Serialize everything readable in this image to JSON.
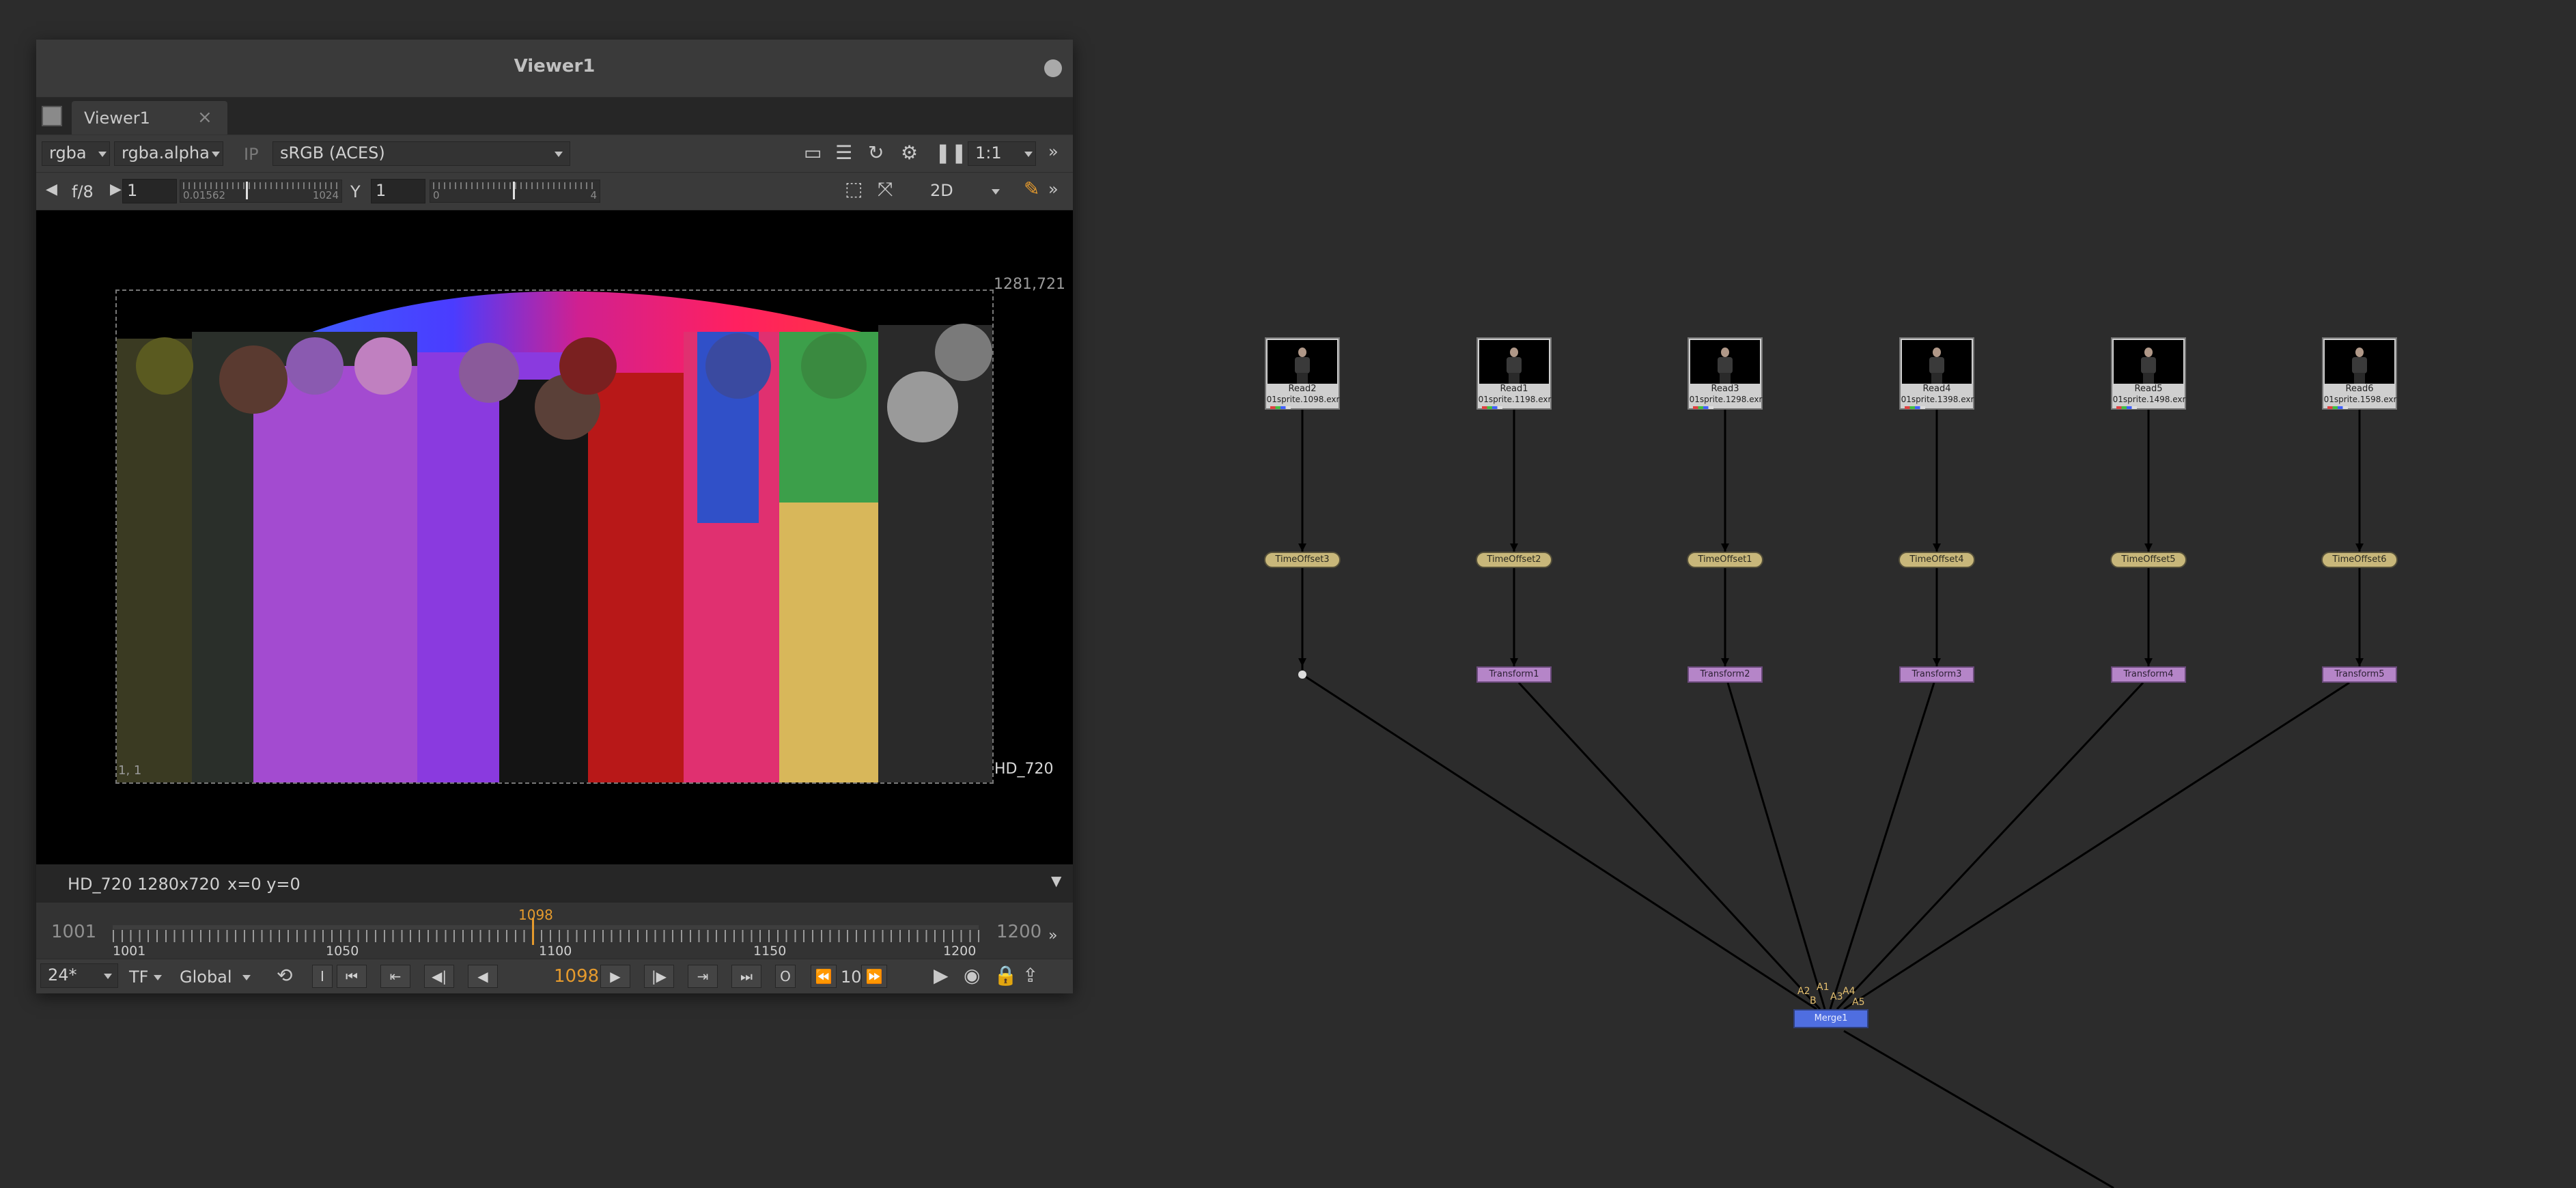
{
  "viewer": {
    "title": "Viewer1",
    "tab_label": "Viewer1",
    "toolbar1": {
      "channels": "rgba",
      "alpha_channel": "rgba.alpha",
      "ip_label": "IP",
      "colorspace": "sRGB (ACES)",
      "zoom": "1:1"
    },
    "toolbar2": {
      "fstop": "f/8",
      "gain_value": "1",
      "gain_ticks": "0.01562",
      "gain_max": "1024",
      "y_label": "Y",
      "gamma_value": "1",
      "gamma_min": "0",
      "gamma_max": "4",
      "view_mode": "2D"
    },
    "canvas": {
      "format_corner": "1281,721",
      "format_name": "HD_720",
      "origin_label": "1, 1"
    },
    "info": {
      "format": "HD_720 1280x720",
      "coords": "x=0 y=0"
    },
    "timeline": {
      "range_start": "1001",
      "range_end": "1200",
      "current_frame": "1098",
      "labels": [
        "1001",
        "1050",
        "1100",
        "1150",
        "1200"
      ]
    },
    "playback": {
      "fps": "24*",
      "tf": "TF",
      "scope": "Global",
      "in_label": "I",
      "out_label": "O",
      "frame": "1098",
      "step": "10"
    }
  },
  "nodes": {
    "reads": [
      {
        "name": "Read2",
        "file": "01sprite.1098.exr"
      },
      {
        "name": "Read1",
        "file": "01sprite.1198.exr"
      },
      {
        "name": "Read3",
        "file": "01sprite.1298.exr"
      },
      {
        "name": "Read4",
        "file": "01sprite.1398.exr"
      },
      {
        "name": "Read5",
        "file": "01sprite.1498.exr"
      },
      {
        "name": "Read6",
        "file": "01sprite.1598.exr"
      }
    ],
    "timeoffsets": [
      "TimeOffset3",
      "TimeOffset2",
      "TimeOffset1",
      "TimeOffset4",
      "TimeOffset5",
      "TimeOffset6"
    ],
    "transforms": [
      "Transform1",
      "Transform2",
      "Transform3",
      "Transform4",
      "Transform5"
    ],
    "merge": "Merge1",
    "merge_inputs": [
      "A2",
      "B",
      "A1",
      "A3",
      "A4",
      "A5"
    ]
  },
  "colors": {
    "background": "#2c2c2c",
    "read_node": "#cfcfcf",
    "timeoffset_node": "#c8b77a",
    "transform_node": "#b585c8",
    "merge_node": "#4f6ee0",
    "accent_orange": "#e59a2d"
  }
}
